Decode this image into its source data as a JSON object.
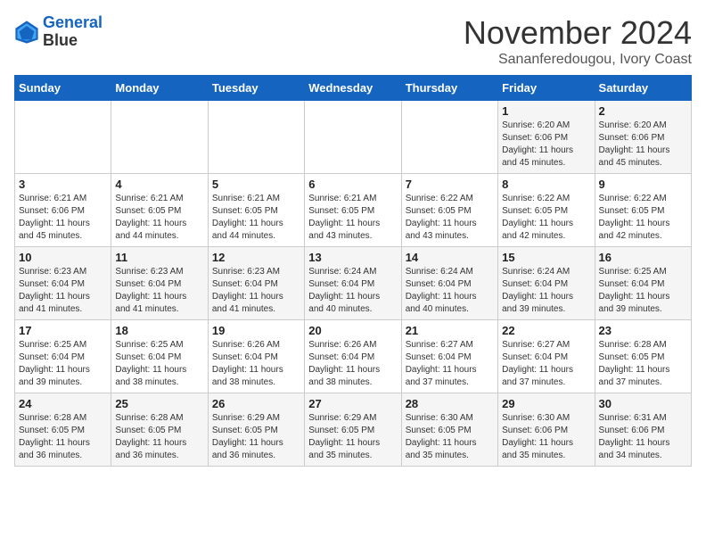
{
  "logo": {
    "line1": "General",
    "line2": "Blue"
  },
  "title": "November 2024",
  "subtitle": "Sananferedougou, Ivory Coast",
  "days_of_week": [
    "Sunday",
    "Monday",
    "Tuesday",
    "Wednesday",
    "Thursday",
    "Friday",
    "Saturday"
  ],
  "weeks": [
    [
      {
        "day": "",
        "info": ""
      },
      {
        "day": "",
        "info": ""
      },
      {
        "day": "",
        "info": ""
      },
      {
        "day": "",
        "info": ""
      },
      {
        "day": "",
        "info": ""
      },
      {
        "day": "1",
        "info": "Sunrise: 6:20 AM\nSunset: 6:06 PM\nDaylight: 11 hours\nand 45 minutes."
      },
      {
        "day": "2",
        "info": "Sunrise: 6:20 AM\nSunset: 6:06 PM\nDaylight: 11 hours\nand 45 minutes."
      }
    ],
    [
      {
        "day": "3",
        "info": "Sunrise: 6:21 AM\nSunset: 6:06 PM\nDaylight: 11 hours\nand 45 minutes."
      },
      {
        "day": "4",
        "info": "Sunrise: 6:21 AM\nSunset: 6:05 PM\nDaylight: 11 hours\nand 44 minutes."
      },
      {
        "day": "5",
        "info": "Sunrise: 6:21 AM\nSunset: 6:05 PM\nDaylight: 11 hours\nand 44 minutes."
      },
      {
        "day": "6",
        "info": "Sunrise: 6:21 AM\nSunset: 6:05 PM\nDaylight: 11 hours\nand 43 minutes."
      },
      {
        "day": "7",
        "info": "Sunrise: 6:22 AM\nSunset: 6:05 PM\nDaylight: 11 hours\nand 43 minutes."
      },
      {
        "day": "8",
        "info": "Sunrise: 6:22 AM\nSunset: 6:05 PM\nDaylight: 11 hours\nand 42 minutes."
      },
      {
        "day": "9",
        "info": "Sunrise: 6:22 AM\nSunset: 6:05 PM\nDaylight: 11 hours\nand 42 minutes."
      }
    ],
    [
      {
        "day": "10",
        "info": "Sunrise: 6:23 AM\nSunset: 6:04 PM\nDaylight: 11 hours\nand 41 minutes."
      },
      {
        "day": "11",
        "info": "Sunrise: 6:23 AM\nSunset: 6:04 PM\nDaylight: 11 hours\nand 41 minutes."
      },
      {
        "day": "12",
        "info": "Sunrise: 6:23 AM\nSunset: 6:04 PM\nDaylight: 11 hours\nand 41 minutes."
      },
      {
        "day": "13",
        "info": "Sunrise: 6:24 AM\nSunset: 6:04 PM\nDaylight: 11 hours\nand 40 minutes."
      },
      {
        "day": "14",
        "info": "Sunrise: 6:24 AM\nSunset: 6:04 PM\nDaylight: 11 hours\nand 40 minutes."
      },
      {
        "day": "15",
        "info": "Sunrise: 6:24 AM\nSunset: 6:04 PM\nDaylight: 11 hours\nand 39 minutes."
      },
      {
        "day": "16",
        "info": "Sunrise: 6:25 AM\nSunset: 6:04 PM\nDaylight: 11 hours\nand 39 minutes."
      }
    ],
    [
      {
        "day": "17",
        "info": "Sunrise: 6:25 AM\nSunset: 6:04 PM\nDaylight: 11 hours\nand 39 minutes."
      },
      {
        "day": "18",
        "info": "Sunrise: 6:25 AM\nSunset: 6:04 PM\nDaylight: 11 hours\nand 38 minutes."
      },
      {
        "day": "19",
        "info": "Sunrise: 6:26 AM\nSunset: 6:04 PM\nDaylight: 11 hours\nand 38 minutes."
      },
      {
        "day": "20",
        "info": "Sunrise: 6:26 AM\nSunset: 6:04 PM\nDaylight: 11 hours\nand 38 minutes."
      },
      {
        "day": "21",
        "info": "Sunrise: 6:27 AM\nSunset: 6:04 PM\nDaylight: 11 hours\nand 37 minutes."
      },
      {
        "day": "22",
        "info": "Sunrise: 6:27 AM\nSunset: 6:04 PM\nDaylight: 11 hours\nand 37 minutes."
      },
      {
        "day": "23",
        "info": "Sunrise: 6:28 AM\nSunset: 6:05 PM\nDaylight: 11 hours\nand 37 minutes."
      }
    ],
    [
      {
        "day": "24",
        "info": "Sunrise: 6:28 AM\nSunset: 6:05 PM\nDaylight: 11 hours\nand 36 minutes."
      },
      {
        "day": "25",
        "info": "Sunrise: 6:28 AM\nSunset: 6:05 PM\nDaylight: 11 hours\nand 36 minutes."
      },
      {
        "day": "26",
        "info": "Sunrise: 6:29 AM\nSunset: 6:05 PM\nDaylight: 11 hours\nand 36 minutes."
      },
      {
        "day": "27",
        "info": "Sunrise: 6:29 AM\nSunset: 6:05 PM\nDaylight: 11 hours\nand 35 minutes."
      },
      {
        "day": "28",
        "info": "Sunrise: 6:30 AM\nSunset: 6:05 PM\nDaylight: 11 hours\nand 35 minutes."
      },
      {
        "day": "29",
        "info": "Sunrise: 6:30 AM\nSunset: 6:06 PM\nDaylight: 11 hours\nand 35 minutes."
      },
      {
        "day": "30",
        "info": "Sunrise: 6:31 AM\nSunset: 6:06 PM\nDaylight: 11 hours\nand 34 minutes."
      }
    ]
  ]
}
